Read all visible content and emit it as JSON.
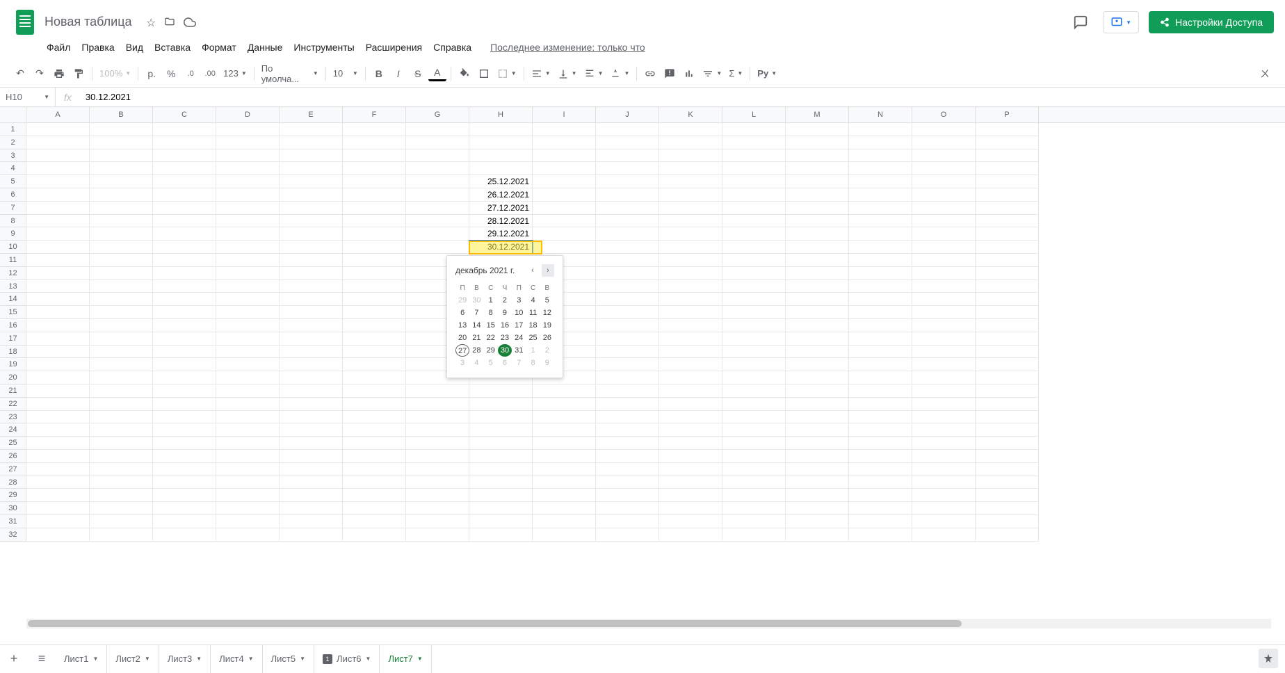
{
  "doc": {
    "title": "Новая таблица"
  },
  "menu": {
    "file": "Файл",
    "edit": "Правка",
    "view": "Вид",
    "insert": "Вставка",
    "format": "Формат",
    "data": "Данные",
    "tools": "Инструменты",
    "extensions": "Расширения",
    "help": "Справка",
    "last_edit": "Последнее изменение: только что"
  },
  "share": {
    "label": "Настройки Доступа"
  },
  "toolbar": {
    "zoom": "100%",
    "currency": "р.",
    "percent": "%",
    "dec_dec": ".0",
    "inc_dec": ".00",
    "format_number": "123",
    "font": "По умолча...",
    "font_size": "10"
  },
  "formula": {
    "cell_ref": "H10",
    "value": "30.12.2021"
  },
  "columns": [
    "A",
    "B",
    "C",
    "D",
    "E",
    "F",
    "G",
    "H",
    "I",
    "J",
    "K",
    "L",
    "M",
    "N",
    "O",
    "P"
  ],
  "row_count": 32,
  "cells": {
    "H5": "25.12.2021",
    "H6": "26.12.2021",
    "H7": "27.12.2021",
    "H8": "28.12.2021",
    "H9": "29.12.2021",
    "H10": "30.12.2021"
  },
  "selected_cell": "H10",
  "datepicker": {
    "title": "декабрь 2021 г.",
    "dow": [
      "П",
      "В",
      "С",
      "Ч",
      "П",
      "С",
      "В"
    ],
    "weeks": [
      [
        {
          "d": 29,
          "o": true
        },
        {
          "d": 30,
          "o": true
        },
        {
          "d": 1
        },
        {
          "d": 2
        },
        {
          "d": 3
        },
        {
          "d": 4
        },
        {
          "d": 5
        }
      ],
      [
        {
          "d": 6
        },
        {
          "d": 7
        },
        {
          "d": 8
        },
        {
          "d": 9
        },
        {
          "d": 10
        },
        {
          "d": 11
        },
        {
          "d": 12
        }
      ],
      [
        {
          "d": 13
        },
        {
          "d": 14
        },
        {
          "d": 15
        },
        {
          "d": 16
        },
        {
          "d": 17
        },
        {
          "d": 18
        },
        {
          "d": 19
        }
      ],
      [
        {
          "d": 20
        },
        {
          "d": 21
        },
        {
          "d": 22
        },
        {
          "d": 23
        },
        {
          "d": 24
        },
        {
          "d": 25
        },
        {
          "d": 26
        }
      ],
      [
        {
          "d": 27,
          "today": true
        },
        {
          "d": 28
        },
        {
          "d": 29
        },
        {
          "d": 30,
          "sel": true
        },
        {
          "d": 31
        },
        {
          "d": 1,
          "o": true
        },
        {
          "d": 2,
          "o": true
        }
      ],
      [
        {
          "d": 3,
          "o": true
        },
        {
          "d": 4,
          "o": true
        },
        {
          "d": 5,
          "o": true
        },
        {
          "d": 6,
          "o": true
        },
        {
          "d": 7,
          "o": true
        },
        {
          "d": 8,
          "o": true
        },
        {
          "d": 9,
          "o": true
        }
      ]
    ]
  },
  "tabs": [
    {
      "label": "Лист1"
    },
    {
      "label": "Лист2"
    },
    {
      "label": "Лист3"
    },
    {
      "label": "Лист4"
    },
    {
      "label": "Лист5"
    },
    {
      "label": "Лист6",
      "badge": "1"
    },
    {
      "label": "Лист7",
      "active": true
    }
  ]
}
